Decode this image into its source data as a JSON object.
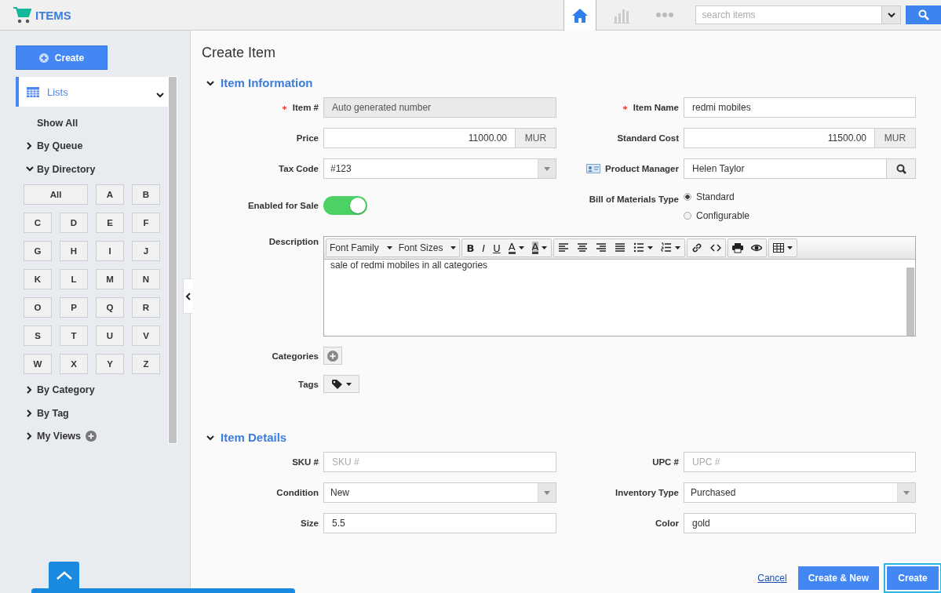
{
  "app": {
    "title": "ITEMS"
  },
  "nav_tabs": [
    {
      "kind": "home",
      "selected": true
    },
    {
      "kind": "chart",
      "selected": false
    },
    {
      "kind": "more",
      "selected": false
    }
  ],
  "search": {
    "placeholder": "search items"
  },
  "sidebar": {
    "create_button": "Create",
    "lists": {
      "label": "Lists",
      "expanded": true
    },
    "items": [
      {
        "label": "Show All",
        "kind": "link"
      },
      {
        "label": "By Queue",
        "kind": "group",
        "expanded": false
      },
      {
        "label": "By Directory",
        "kind": "group",
        "expanded": true,
        "letters": [
          "All",
          "A",
          "B",
          "C",
          "D",
          "E",
          "F",
          "G",
          "H",
          "I",
          "J",
          "K",
          "L",
          "M",
          "N",
          "O",
          "P",
          "Q",
          "R",
          "S",
          "T",
          "U",
          "V",
          "W",
          "X",
          "Y",
          "Z"
        ]
      },
      {
        "label": "By Category",
        "kind": "group",
        "expanded": false
      },
      {
        "label": "By Tag",
        "kind": "group",
        "expanded": false
      },
      {
        "label": "My Views",
        "kind": "group",
        "expanded": false,
        "addable": true
      }
    ]
  },
  "page_title": "Create Item",
  "sections": [
    {
      "title": "Item Information",
      "expanded": true,
      "fields": [
        {
          "label": "Item #",
          "kind": "text",
          "required": true,
          "disabled": true,
          "value": "Auto generated number"
        },
        {
          "label": "Item Name",
          "kind": "text",
          "required": true,
          "disabled": false,
          "value": "redmi mobiles"
        },
        {
          "label": "Price",
          "kind": "money",
          "value": "11000.00",
          "currency": "MUR"
        },
        {
          "label": "Standard Cost",
          "kind": "money",
          "value": "11500.00",
          "currency": "MUR"
        },
        {
          "label": "Tax Code",
          "kind": "select",
          "value": "#123"
        },
        {
          "label": "Product Manager",
          "kind": "lookup",
          "value": "Helen Taylor"
        },
        {
          "label": "Enabled for Sale",
          "kind": "toggle",
          "on": true
        },
        {
          "label": "Bill of Materials Type",
          "kind": "radio",
          "options": [
            {
              "label": "Standard",
              "selected": true
            },
            {
              "label": "Configurable",
              "selected": false
            }
          ]
        },
        {
          "label": "Description",
          "kind": "editor",
          "value": "sale of redmi mobiles in all categories",
          "toolbar": [
            [
              {
                "kind": "dropdown",
                "label": "Font Family"
              },
              {
                "kind": "dropdown",
                "label": "Font Sizes"
              }
            ],
            [
              {
                "kind": "bold",
                "label": "B"
              },
              {
                "kind": "italic",
                "label": "I"
              },
              {
                "kind": "underline",
                "label": "U"
              },
              {
                "kind": "color",
                "label": "A"
              },
              {
                "kind": "highlight",
                "label": "A"
              }
            ],
            [
              {
                "kind": "align-left"
              },
              {
                "kind": "align-center"
              },
              {
                "kind": "align-right"
              },
              {
                "kind": "justify"
              },
              {
                "kind": "bullets"
              },
              {
                "kind": "numbers"
              }
            ],
            [
              {
                "kind": "link"
              },
              {
                "kind": "code"
              }
            ],
            [
              {
                "kind": "print"
              },
              {
                "kind": "preview"
              }
            ],
            [
              {
                "kind": "table"
              }
            ]
          ]
        },
        {
          "label": "Categories",
          "kind": "add"
        },
        {
          "label": "Tags",
          "kind": "tags"
        }
      ]
    },
    {
      "title": "Item Details",
      "expanded": true,
      "fields": [
        {
          "label": "SKU #",
          "kind": "text",
          "required": false,
          "disabled": false,
          "placeholder": "SKU #"
        },
        {
          "label": "UPC #",
          "kind": "text",
          "required": false,
          "disabled": false,
          "placeholder": "UPC #"
        },
        {
          "label": "Condition",
          "kind": "select",
          "value": "New"
        },
        {
          "label": "Inventory Type",
          "kind": "select",
          "value": "Purchased"
        },
        {
          "label": "Size",
          "kind": "text",
          "required": false,
          "disabled": false,
          "value": "5.5"
        },
        {
          "label": "Color",
          "kind": "text",
          "required": false,
          "disabled": false,
          "value": "gold"
        }
      ]
    }
  ],
  "actions": {
    "cancel": "Cancel",
    "create_new": "Create & New",
    "create": "Create"
  }
}
